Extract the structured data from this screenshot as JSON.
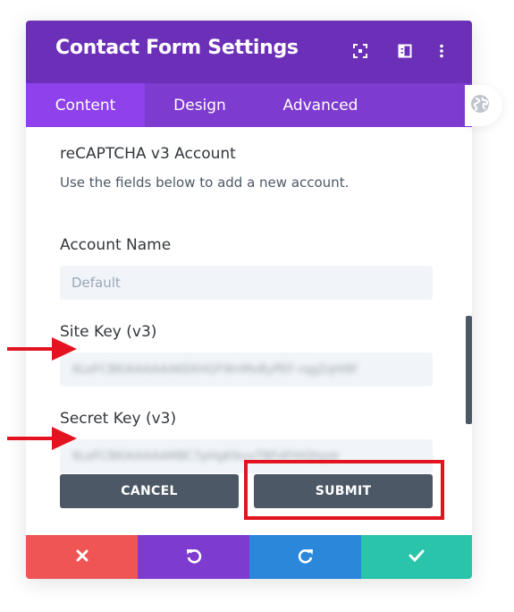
{
  "modal": {
    "title": "Contact Form Settings"
  },
  "tabs": [
    {
      "label": "Content",
      "active": true
    },
    {
      "label": "Design",
      "active": false
    },
    {
      "label": "Advanced",
      "active": false
    }
  ],
  "section": {
    "title": "reCAPTCHA v3 Account",
    "description": "Use the fields below to add a new account."
  },
  "fields": {
    "account_name": {
      "label": "Account Name",
      "value": "",
      "placeholder": "Default"
    },
    "site_key": {
      "label": "Site Key (v3)",
      "value": "6LeFC8KIAAAAAAKEKHGFWnMxByPEF-rqgZqHI8f",
      "obscured": true
    },
    "secret_key": {
      "label": "Secret Key (v3)",
      "value": "6LeFC8KIAAAAAMBC7pHgKIkuvTBFdFHiQhpdr",
      "obscured": true
    }
  },
  "buttons": {
    "cancel": "CANCEL",
    "submit": "SUBMIT"
  },
  "icons": {
    "header": [
      "fullscreen-icon",
      "split-view-icon",
      "more-options-icon"
    ],
    "footer": [
      "close-icon",
      "undo-icon",
      "redo-icon",
      "check-icon"
    ],
    "side": "globe-icon"
  },
  "colors": {
    "header": "#6b2fb8",
    "tabs": "#7e3bd0",
    "tab_active": "#8f42ec",
    "footer_close": "#ef5555",
    "footer_undo": "#7d3bd0",
    "footer_redo": "#2b87da",
    "footer_save": "#29c4a9",
    "highlight": "#e3141f"
  }
}
